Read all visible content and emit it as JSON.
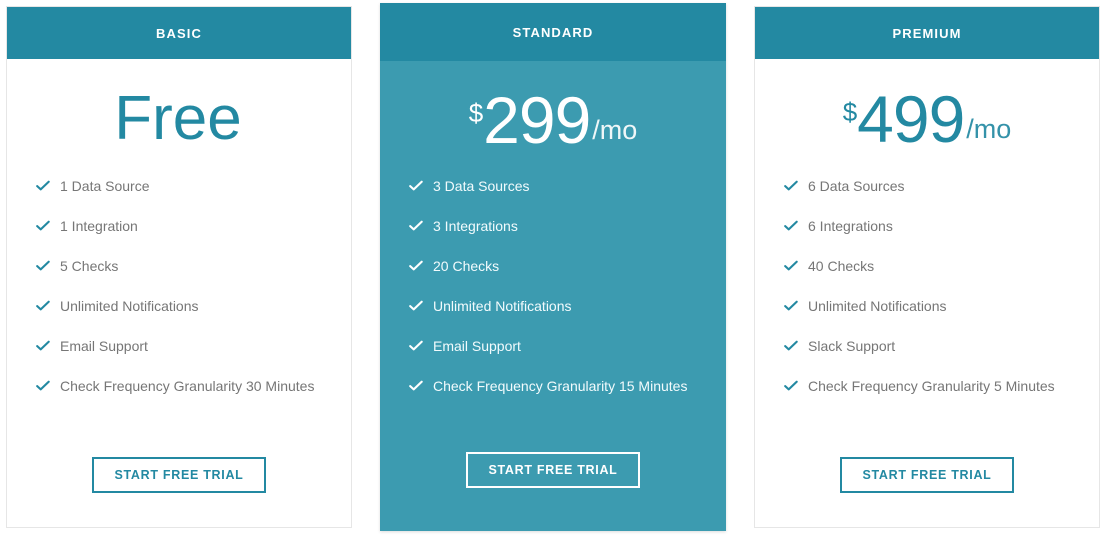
{
  "plans": [
    {
      "id": "basic",
      "name": "BASIC",
      "currency": "",
      "amount": "Free",
      "period": "",
      "is_free": true,
      "featured": false,
      "features": [
        "1 Data Source",
        "1 Integration",
        "5 Checks",
        "Unlimited Notifications",
        "Email Support",
        "Check Frequency Granularity 30 Minutes"
      ],
      "cta_label": "START FREE TRIAL"
    },
    {
      "id": "standard",
      "name": "STANDARD",
      "currency": "$",
      "amount": "299",
      "period": "/mo",
      "is_free": false,
      "featured": true,
      "features": [
        "3 Data Sources",
        "3 Integrations",
        "20 Checks",
        "Unlimited Notifications",
        "Email Support",
        "Check Frequency Granularity 15 Minutes"
      ],
      "cta_label": "START FREE TRIAL"
    },
    {
      "id": "premium",
      "name": "PREMIUM",
      "currency": "$",
      "amount": "499",
      "period": "/mo",
      "is_free": false,
      "featured": false,
      "features": [
        "6 Data Sources",
        "6 Integrations",
        "40 Checks",
        "Unlimited Notifications",
        "Slack Support",
        "Check Frequency Granularity 5 Minutes"
      ],
      "cta_label": "START FREE TRIAL"
    }
  ],
  "icons": {
    "check": "check-icon"
  },
  "colors": {
    "header_teal": "#2389a2",
    "featured_body_teal": "#3c9bb0",
    "accent": "#2389a2",
    "feature_text": "#767676",
    "card_border": "#e6e6e6",
    "page_background": "#ffffff"
  }
}
